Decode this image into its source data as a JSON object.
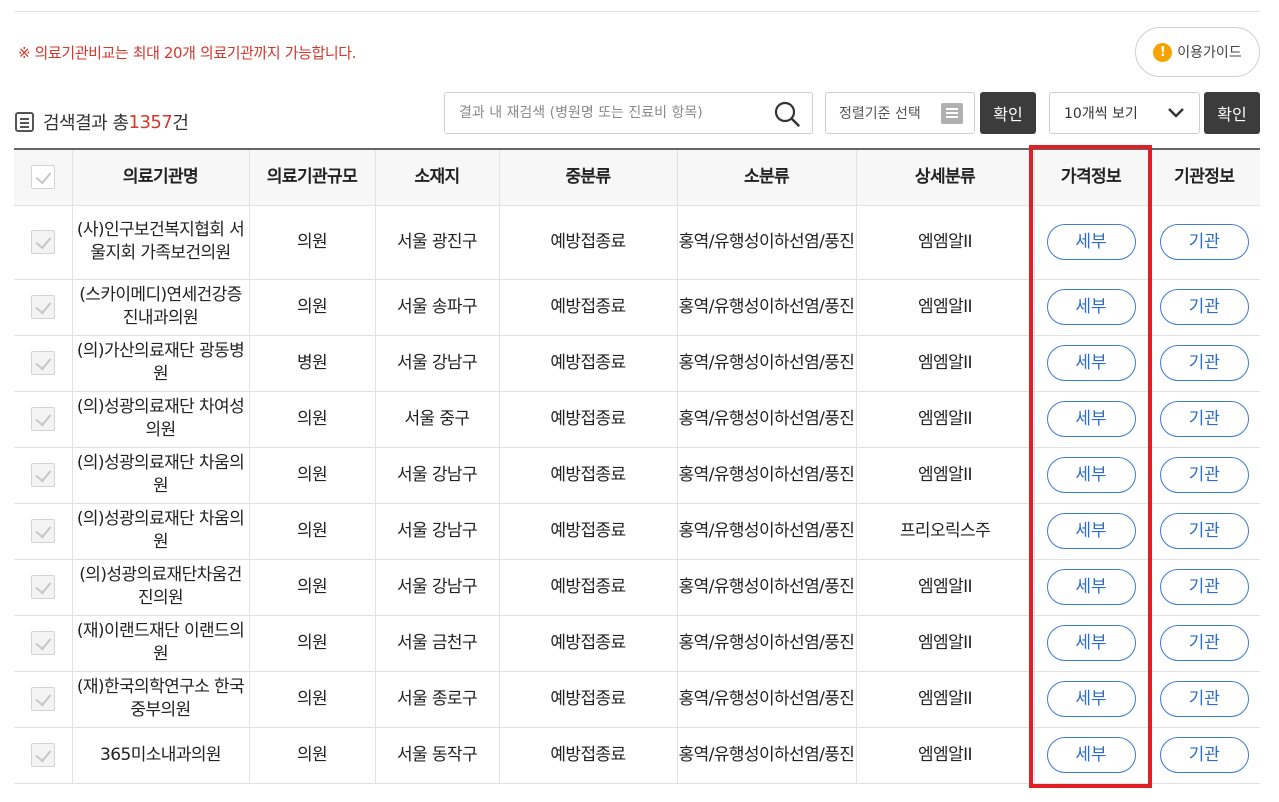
{
  "notice": "※ 의료기관비교는 최대 20개 의료기관까지 가능합니다.",
  "guide": {
    "icon": "exclamation-icon",
    "label": "이용가이드"
  },
  "result": {
    "prefix": "검색결과 총 ",
    "count": "1357",
    "suffix": "건"
  },
  "search": {
    "placeholder": "결과 내 재검색 (병원명 또는 진료비 항목)",
    "value": ""
  },
  "sort": {
    "label": "정렬기준 선택"
  },
  "confirm_label": "확인",
  "per_page": {
    "value": "10개씩 보기"
  },
  "table": {
    "headers": [
      "의료기관명",
      "의료기관규모",
      "소재지",
      "중분류",
      "소분류",
      "상세분류",
      "가격정보",
      "기관정보"
    ],
    "detail_label": "세부",
    "org_label": "기관",
    "rows": [
      {
        "name": "(사)인구보건복지협회 서울지회 가족보건의원",
        "size": "의원",
        "location": "서울 광진구",
        "mid": "예방접종료",
        "sub": "홍역/유행성이하선염/풍진",
        "detail": "엠엠알II"
      },
      {
        "name": "(스카이메디)연세건강증진내과의원",
        "size": "의원",
        "location": "서울 송파구",
        "mid": "예방접종료",
        "sub": "홍역/유행성이하선염/풍진",
        "detail": "엠엠알II"
      },
      {
        "name": "(의)가산의료재단 광동병원",
        "size": "병원",
        "location": "서울 강남구",
        "mid": "예방접종료",
        "sub": "홍역/유행성이하선염/풍진",
        "detail": "엠엠알II"
      },
      {
        "name": "(의)성광의료재단 차여성의원",
        "size": "의원",
        "location": "서울 중구",
        "mid": "예방접종료",
        "sub": "홍역/유행성이하선염/풍진",
        "detail": "엠엠알II"
      },
      {
        "name": "(의)성광의료재단 차움의원",
        "size": "의원",
        "location": "서울 강남구",
        "mid": "예방접종료",
        "sub": "홍역/유행성이하선염/풍진",
        "detail": "엠엠알II"
      },
      {
        "name": "(의)성광의료재단 차움의원",
        "size": "의원",
        "location": "서울 강남구",
        "mid": "예방접종료",
        "sub": "홍역/유행성이하선염/풍진",
        "detail": "프리오릭스주"
      },
      {
        "name": "(의)성광의료재단차움건진의원",
        "size": "의원",
        "location": "서울 강남구",
        "mid": "예방접종료",
        "sub": "홍역/유행성이하선염/풍진",
        "detail": "엠엠알II"
      },
      {
        "name": "(재)이랜드재단 이랜드의원",
        "size": "의원",
        "location": "서울 금천구",
        "mid": "예방접종료",
        "sub": "홍역/유행성이하선염/풍진",
        "detail": "엠엠알II"
      },
      {
        "name": "(재)한국의학연구소 한국중부의원",
        "size": "의원",
        "location": "서울 종로구",
        "mid": "예방접종료",
        "sub": "홍역/유행성이하선염/풍진",
        "detail": "엠엠알II"
      },
      {
        "name": "365미소내과의원",
        "size": "의원",
        "location": "서울 동작구",
        "mid": "예방접종료",
        "sub": "홍역/유행성이하선염/풍진",
        "detail": "엠엠알II"
      }
    ]
  },
  "colors": {
    "notice_red": "#d4372c",
    "highlight_frame": "#e02027",
    "pill_blue": "#2d6cc4",
    "dark_button": "#3c3c3c"
  }
}
